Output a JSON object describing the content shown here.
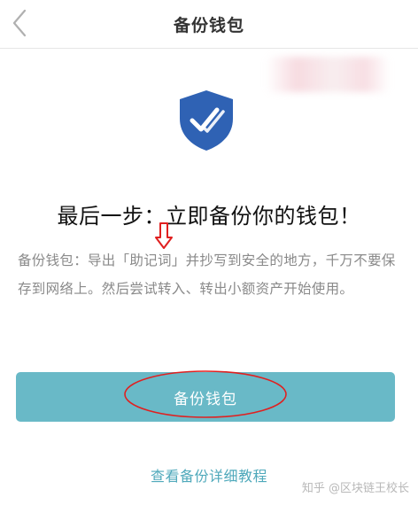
{
  "header": {
    "title": "备份钱包",
    "back_icon": "chevron-left-icon"
  },
  "hero": {
    "icon": "shield-check-icon",
    "shield_color": "#2f62b4"
  },
  "main": {
    "headline": "最后一步：立即备份你的钱包！",
    "description": "备份钱包：导出「助记词」并抄写到安全的地方，千万不要保存到网络上。然后尝试转入、转出小额资产开始使用。"
  },
  "actions": {
    "backup_button_label": "备份钱包",
    "tutorial_link_label": "查看备份详细教程"
  },
  "annotations": {
    "arrow_color": "#e02020",
    "ellipse_color": "#e02020"
  },
  "watermark": {
    "text": "知乎 @区块链王校长"
  },
  "colors": {
    "accent_button": "#69b9c7",
    "link": "#4fa9bb",
    "text_secondary": "#8a8a8a"
  }
}
